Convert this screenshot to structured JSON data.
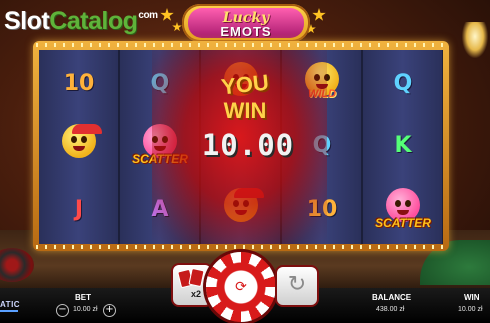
{
  "logo": {
    "part1": "Slot",
    "part2": "Catalog",
    "part3": "com"
  },
  "game_title": {
    "top": "Lucky",
    "bottom": "EMOTS"
  },
  "reels": [
    [
      {
        "kind": "letter",
        "text": "10",
        "color": "c-gold"
      },
      {
        "kind": "emoji",
        "face": "yellow",
        "cap": true
      },
      {
        "kind": "letter",
        "text": "J",
        "color": "c-red"
      }
    ],
    [
      {
        "kind": "letter",
        "text": "Q",
        "color": "c-blue"
      },
      {
        "kind": "emoji",
        "face": "pink",
        "tag": "SCATTER"
      },
      {
        "kind": "letter",
        "text": "A",
        "color": "c-purple"
      }
    ],
    [
      {
        "kind": "emoji",
        "face": "yellow"
      },
      {
        "kind": "blank"
      },
      {
        "kind": "emoji",
        "face": "yellow",
        "cap": true
      }
    ],
    [
      {
        "kind": "emoji",
        "face": "yellow",
        "tag": "WILD",
        "tagclass": "wild"
      },
      {
        "kind": "letter",
        "text": "Q",
        "color": "c-blue"
      },
      {
        "kind": "letter",
        "text": "10",
        "color": "c-gold"
      }
    ],
    [
      {
        "kind": "letter",
        "text": "Q",
        "color": "c-blue"
      },
      {
        "kind": "letter",
        "text": "K",
        "color": "c-green"
      },
      {
        "kind": "emoji",
        "face": "pink",
        "tag": "SCATTER"
      }
    ]
  ],
  "win_banner": {
    "line1": "YOU",
    "line2": "WIN",
    "amount": "10.00"
  },
  "controls": {
    "double_label": "x2"
  },
  "footer": {
    "provider": "ATIC",
    "bet_label": "BET",
    "bet_value": "10.00 zł",
    "minus": "−",
    "plus": "+",
    "balance_label": "BALANCE",
    "balance_value": "438.00 zł",
    "win_label": "WIN",
    "win_value": "10.00 zł"
  },
  "colors": {
    "accent_red": "#d81a1a",
    "frame_gold": "#f0b23e",
    "reel_bg": "#2a305a"
  },
  "icons": {
    "spin": "spin-chip-icon",
    "autoplay": "autoplay-refresh-icon",
    "gamble": "gamble-cards-icon"
  }
}
